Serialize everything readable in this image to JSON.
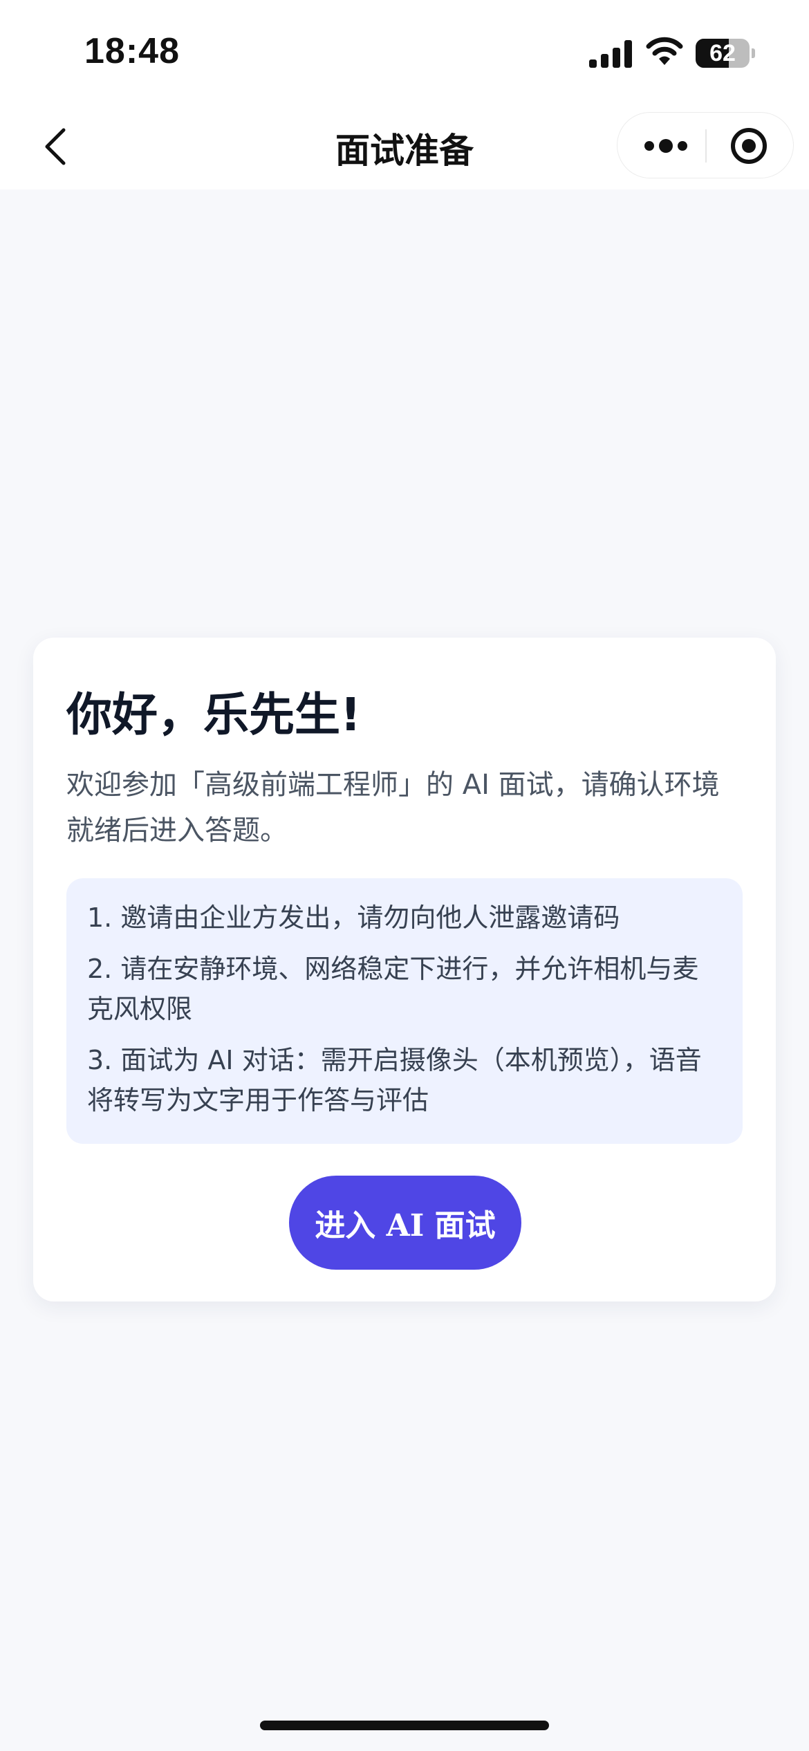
{
  "status_bar": {
    "time": "18:48",
    "battery": "62",
    "battery_level": 0.62,
    "icons": [
      "signal-icon",
      "wifi-icon",
      "battery-icon"
    ]
  },
  "nav": {
    "title": "面试准备",
    "icons": [
      "back-arrow-icon",
      "more-dots-icon",
      "close-target-icon"
    ]
  },
  "card": {
    "greeting": "你好，乐先生!",
    "intro": "欢迎参加「高级前端工程师」的 AI 面试，请确认环境就绪后进入答题。",
    "notices": [
      "1. 邀请由企业方发出，请勿向他人泄露邀请码",
      "2. 请在安静环境、网络稳定下进行，并允许相机与麦克风权限",
      "3. 面试为 AI 对话：需开启摄像头（本机预览），语音将转写为文字用于作答与评估"
    ],
    "enter_button": "进入 AI 面试"
  },
  "colors": {
    "accent": "#4f46e5",
    "notice_bg": "#eef2ff",
    "page_bg": "#f7f8fb"
  }
}
